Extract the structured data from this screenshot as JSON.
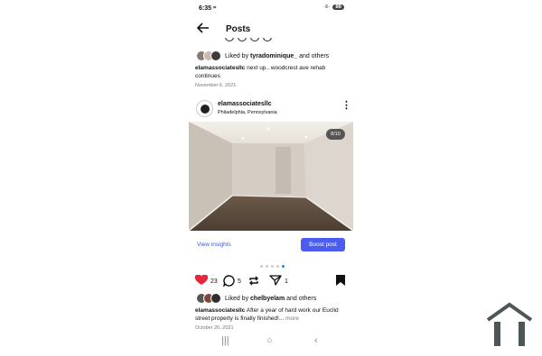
{
  "status_bar": {
    "time": "6:35",
    "extra_icon": "⌗",
    "signal": "·≡·",
    "battery": "86"
  },
  "header": {
    "title": "Posts",
    "back_icon": "arrow-left"
  },
  "prev_post": {
    "liked_by_prefix": "Liked by ",
    "liked_by_user": "tyradominique_",
    "liked_by_suffix": " and others",
    "caption_user": "elamassociatesllc",
    "caption_text": " next up.. woodcrest ave rehab continues",
    "date": "November 6, 2021"
  },
  "post": {
    "username": "elamassociatesllc",
    "location": "Philadelphia, Pennsylvania",
    "more_icon": "⋮",
    "image_counter": "8/10",
    "view_insights": "View insights",
    "boost_post": "Boost post",
    "likes_count": "23",
    "comments_count": "5",
    "shares_count": "1",
    "liked_by_prefix": "Liked by ",
    "liked_by_user": "chelbyelam",
    "liked_by_suffix": " and others",
    "caption_user": "elamassociatesllc",
    "caption_text": " After a year of hard work our Euclid street property is finally finished!...",
    "caption_more": " more",
    "date": "October 26, 2021"
  },
  "nav": {
    "recent": "|||",
    "home": "○",
    "back": "‹"
  },
  "colors": {
    "accent": "#4a5df0",
    "link": "#3a5bd9",
    "heart": "#e8253c"
  }
}
